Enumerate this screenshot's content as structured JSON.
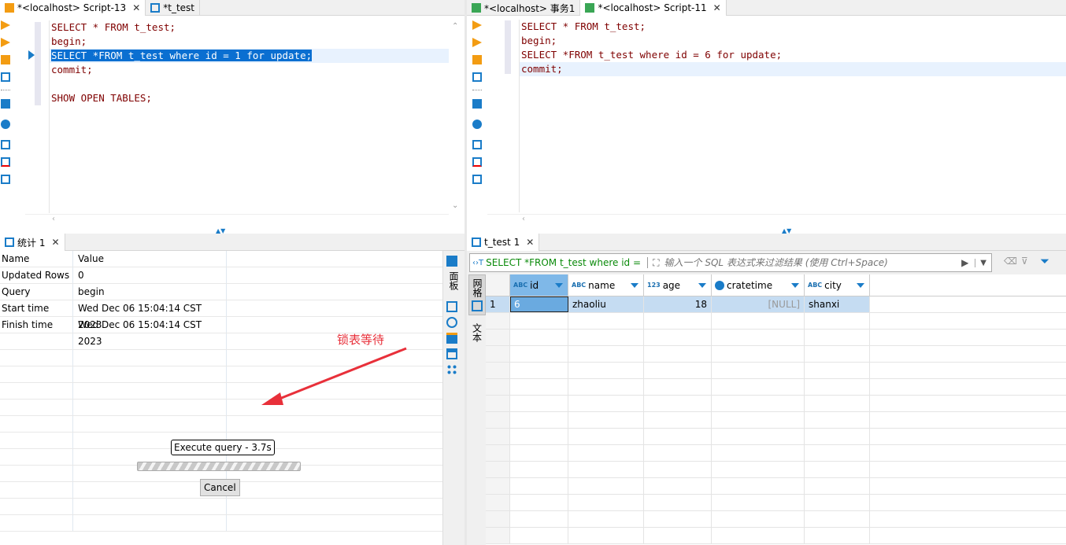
{
  "left_tabs": [
    {
      "label": "*<localhost> Script-13",
      "active": true
    },
    {
      "label": "*t_test",
      "active": false
    }
  ],
  "right_tabs": [
    {
      "label": "*<localhost> 事务1",
      "active": false
    },
    {
      "label": "*<localhost> Script-11",
      "active": true
    }
  ],
  "left_editor": {
    "lines": [
      "SELECT * FROM t_test;",
      "begin;",
      "SELECT *FROM t_test where id = 1 for update;",
      "commit;",
      "",
      "SHOW OPEN TABLES;"
    ],
    "selected_line": 2
  },
  "right_editor": {
    "lines": [
      "SELECT * FROM t_test;",
      "begin;",
      "SELECT *FROM t_test where id = 6 for update;",
      "commit;"
    ],
    "current_line": 3
  },
  "stats_panel": {
    "tab_label": "统计 1",
    "headers": [
      "Name",
      "Value"
    ],
    "rows": [
      [
        "Updated Rows",
        "0"
      ],
      [
        "Query",
        "begin"
      ],
      [
        "Start time",
        "Wed Dec 06 15:04:14 CST 2023"
      ],
      [
        "Finish time",
        "Wed Dec 06 15:04:14 CST 2023"
      ]
    ],
    "side_tab": "面板"
  },
  "annotation": {
    "text": "锁表等待",
    "color": "#e8303a"
  },
  "progress": {
    "label": "Execute query - 3.7s",
    "cancel": "Cancel",
    "state": "indeterminate"
  },
  "results": {
    "tab_label": "t_test 1",
    "query": "SELECT *FROM t_test where id =",
    "filter_placeholder": "输入一个 SQL 表达式来过滤结果 (使用 Ctrl+Space)",
    "side_tabs": [
      "网格",
      "文本"
    ],
    "columns": [
      {
        "name": "id",
        "type": "ABC"
      },
      {
        "name": "name",
        "type": "ABC"
      },
      {
        "name": "age",
        "type": "123"
      },
      {
        "name": "cratetime",
        "type": "clock"
      },
      {
        "name": "city",
        "type": "ABC"
      }
    ],
    "rows": [
      {
        "num": "1",
        "cells": [
          "6",
          "zhaoliu",
          "18",
          "[NULL]",
          "shanxi"
        ]
      }
    ]
  },
  "colors": {
    "selection": "#0a6fd1",
    "accent": "#1a7cc8",
    "row_selected": "#c5dcf2"
  }
}
